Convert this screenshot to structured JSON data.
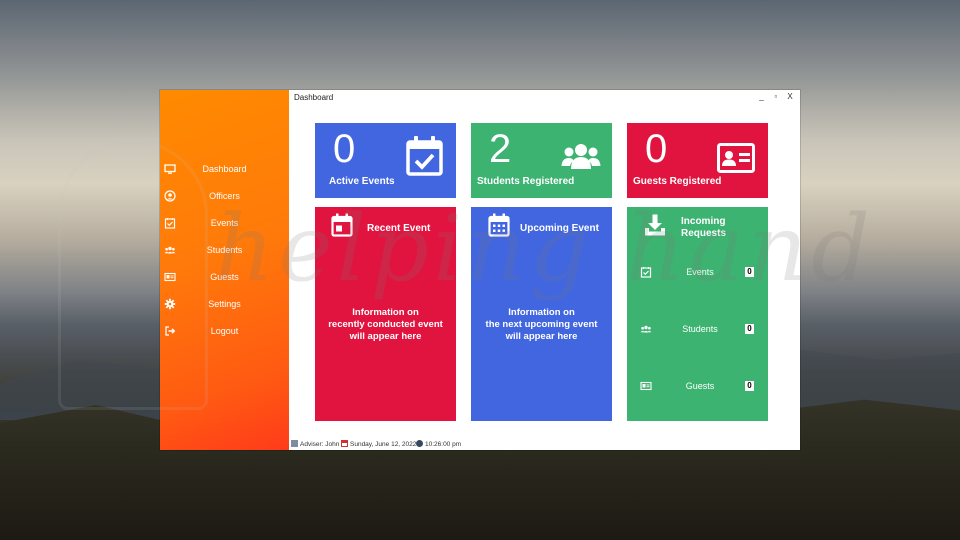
{
  "window": {
    "title": "Dashboard",
    "controls": {
      "minimize": "_",
      "maximize": "▫",
      "close": "X"
    }
  },
  "sidebar": {
    "items": [
      {
        "label": "Dashboard",
        "icon": "monitor-icon"
      },
      {
        "label": "Officers",
        "icon": "user-circle-icon"
      },
      {
        "label": "Events",
        "icon": "calendar-check-icon"
      },
      {
        "label": "Students",
        "icon": "users-icon"
      },
      {
        "label": "Guests",
        "icon": "id-card-icon"
      },
      {
        "label": "Settings",
        "icon": "gear-icon"
      },
      {
        "label": "Logout",
        "icon": "logout-icon"
      }
    ]
  },
  "stats": {
    "active_events": {
      "value": "0",
      "label": "Active Events",
      "color": "#4166df"
    },
    "students_registered": {
      "value": "2",
      "label": "Students Registered",
      "color": "#3cb371"
    },
    "guests_registered": {
      "value": "0",
      "label": "Guests Registered",
      "color": "#e0143f"
    }
  },
  "panels": {
    "recent_event": {
      "title": "Recent Event",
      "message_lines": [
        "Information on",
        "recently conducted event",
        "will appear here"
      ]
    },
    "upcoming_event": {
      "title": "Upcoming Event",
      "message_lines": [
        "Information on",
        "the next upcoming event",
        "will appear here"
      ]
    },
    "incoming_requests": {
      "title_lines": [
        "Incoming",
        "Requests"
      ],
      "rows": [
        {
          "label": "Events",
          "count": "0"
        },
        {
          "label": "Students",
          "count": "0"
        },
        {
          "label": "Guests",
          "count": "0"
        }
      ]
    }
  },
  "statusbar": {
    "adviser": "Adviser: John",
    "date": "Sunday, June 12, 2022",
    "time": "10:26:00 pm"
  },
  "watermark": "helping hand"
}
